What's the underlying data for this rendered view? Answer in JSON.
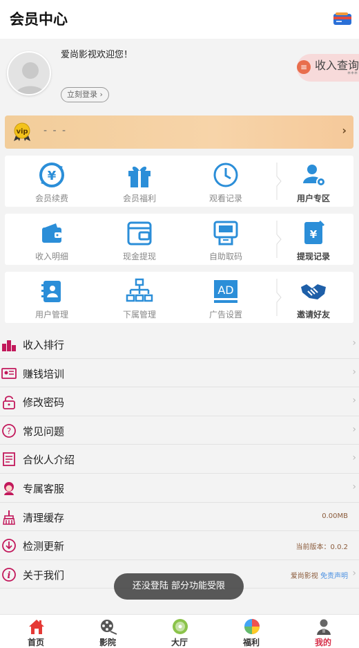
{
  "header": {
    "title": "会员中心",
    "icon": "card-icon"
  },
  "profile": {
    "welcome": "爱尚影视欢迎您！",
    "login_label": "立刻登录",
    "income_query": "收入查询",
    "income_stars": "***"
  },
  "vip": {
    "label": "vip",
    "status": "- - -"
  },
  "grids": [
    {
      "items": [
        {
          "label": "会员续费",
          "icon": "yuan-refresh-icon"
        },
        {
          "label": "会员福利",
          "icon": "gift-icon"
        },
        {
          "label": "观看记录",
          "icon": "clock-icon"
        },
        {
          "label": "用户专区",
          "icon": "user-settings-icon"
        }
      ]
    },
    {
      "items": [
        {
          "label": "收入明细",
          "icon": "wallet-icon"
        },
        {
          "label": "现金提现",
          "icon": "cash-wallet-icon"
        },
        {
          "label": "自助取码",
          "icon": "atm-icon"
        },
        {
          "label": "提现记录",
          "icon": "yuan-card-icon"
        }
      ]
    },
    {
      "items": [
        {
          "label": "用户管理",
          "icon": "contacts-icon"
        },
        {
          "label": "下属管理",
          "icon": "org-chart-icon"
        },
        {
          "label": "广告设置",
          "icon": "ad-icon"
        },
        {
          "label": "邀请好友",
          "icon": "handshake-icon"
        }
      ]
    }
  ],
  "menu": [
    {
      "label": "收入排行",
      "icon": "ranking-icon",
      "right": ""
    },
    {
      "label": "赚钱培训",
      "icon": "training-icon",
      "right": ""
    },
    {
      "label": "修改密码",
      "icon": "lock-icon",
      "right": ""
    },
    {
      "label": "常见问题",
      "icon": "question-icon",
      "right": ""
    },
    {
      "label": "合伙人介绍",
      "icon": "document-icon",
      "right": ""
    },
    {
      "label": "专属客服",
      "icon": "service-icon",
      "right": ""
    },
    {
      "label": "清理缓存",
      "icon": "broom-icon",
      "right": "0.00MB"
    },
    {
      "label": "检测更新",
      "icon": "update-icon",
      "right": "当前版本：0.0.2"
    },
    {
      "label": "关于我们",
      "icon": "info-icon",
      "right": "爱尚影视",
      "right_link": "免责声明"
    }
  ],
  "toast": "还没登陆 部分功能受限",
  "tabs": [
    {
      "label": "首页",
      "icon": "home-icon"
    },
    {
      "label": "影院",
      "icon": "film-reel-icon"
    },
    {
      "label": "大厅",
      "icon": "disc-icon"
    },
    {
      "label": "福利",
      "icon": "pie-icon"
    },
    {
      "label": "我的",
      "icon": "profile-icon",
      "active": true
    }
  ],
  "colors": {
    "accent": "#d7304a",
    "blue": "#2b8ed8",
    "menu_icon": "#c2185b"
  }
}
